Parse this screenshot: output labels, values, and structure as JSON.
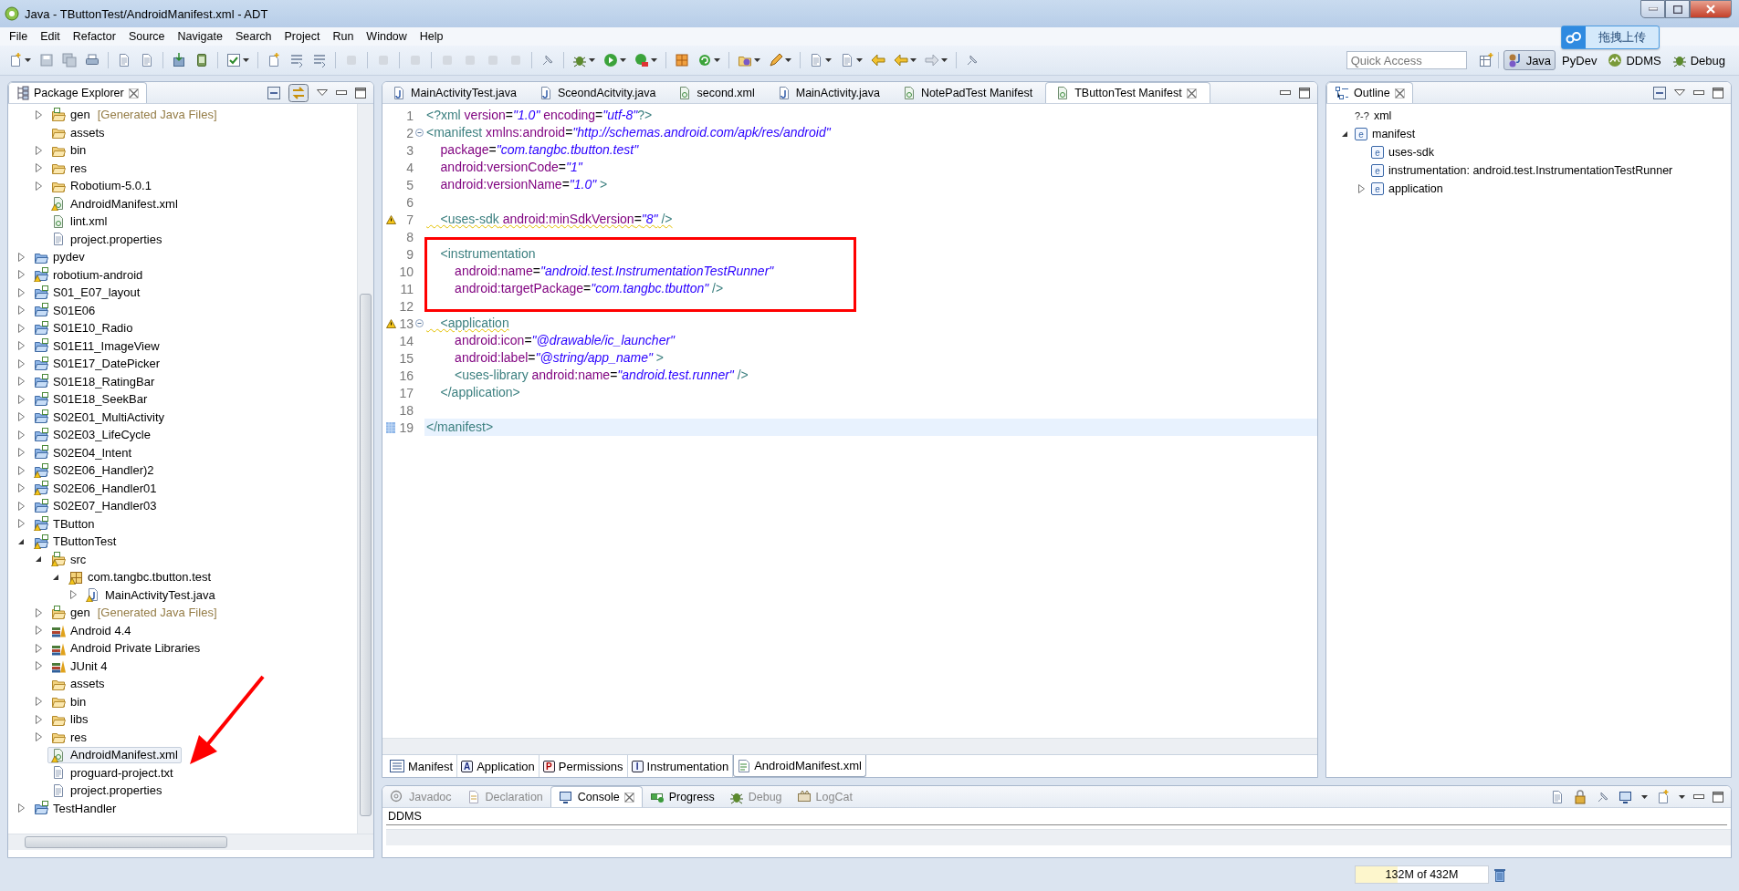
{
  "window": {
    "title": "Java - TButtonTest/AndroidManifest.xml - ADT"
  },
  "menu": [
    "File",
    "Edit",
    "Refactor",
    "Source",
    "Navigate",
    "Search",
    "Project",
    "Run",
    "Window",
    "Help"
  ],
  "quick_access": {
    "placeholder": "Quick Access"
  },
  "perspectives": [
    {
      "label": "Java",
      "kind": "java",
      "selected": true
    },
    {
      "label": "PyDev",
      "kind": "pydev",
      "selected": false
    },
    {
      "label": "DDMS",
      "kind": "ddms",
      "selected": false
    },
    {
      "label": "Debug",
      "kind": "debug",
      "selected": false
    }
  ],
  "upload_widget": {
    "label": "拖拽上传"
  },
  "package_explorer": {
    "title": "Package Explorer",
    "scrolled_children": [
      {
        "label": "gen",
        "note": "[Generated Java Files]",
        "kind": "source-folder",
        "expanded": false,
        "warning": false,
        "selected": false
      },
      {
        "label": "assets",
        "kind": "folder",
        "warning": false,
        "selected": false
      },
      {
        "label": "bin",
        "kind": "folder",
        "expanded": false,
        "warning": false,
        "selected": false
      },
      {
        "label": "res",
        "kind": "folder",
        "expanded": false,
        "warning": false,
        "selected": false
      },
      {
        "label": "Robotium-5.0.1",
        "kind": "plain-folder",
        "expanded": false,
        "warning": false,
        "selected": false
      },
      {
        "label": "AndroidManifest.xml",
        "kind": "xml-file",
        "warning": true,
        "selected": false
      },
      {
        "label": "lint.xml",
        "kind": "xml-file",
        "warning": false,
        "selected": false
      },
      {
        "label": "project.properties",
        "kind": "text-file",
        "warning": false,
        "selected": false
      }
    ],
    "projects": [
      {
        "label": "pydev",
        "kind": "project",
        "expanded": false,
        "warning": false,
        "selected": false
      },
      {
        "label": "robotium-android",
        "kind": "android-project",
        "expanded": false,
        "warning": true,
        "selected": false
      },
      {
        "label": "S01_E07_layout",
        "kind": "android-project",
        "expanded": false,
        "warning": false,
        "selected": false
      },
      {
        "label": "S01E06",
        "kind": "android-project",
        "expanded": false,
        "warning": false,
        "selected": false
      },
      {
        "label": "S01E10_Radio",
        "kind": "android-project",
        "expanded": false,
        "warning": false,
        "selected": false
      },
      {
        "label": "S01E11_ImageView",
        "kind": "android-project",
        "expanded": false,
        "warning": false,
        "selected": false
      },
      {
        "label": "S01E17_DatePicker",
        "kind": "android-project",
        "expanded": false,
        "warning": false,
        "selected": false
      },
      {
        "label": "S01E18_RatingBar",
        "kind": "android-project",
        "expanded": false,
        "warning": false,
        "selected": false
      },
      {
        "label": "S01E18_SeekBar",
        "kind": "android-project",
        "expanded": false,
        "warning": false,
        "selected": false
      },
      {
        "label": "S02E01_MultiActivity",
        "kind": "android-project",
        "expanded": false,
        "warning": false,
        "selected": false
      },
      {
        "label": "S02E03_LifeCycle",
        "kind": "android-project",
        "expanded": false,
        "warning": false,
        "selected": false
      },
      {
        "label": "S02E04_Intent",
        "kind": "android-project",
        "expanded": false,
        "warning": false,
        "selected": false
      },
      {
        "label": "S02E06_Handler)2",
        "kind": "android-project",
        "expanded": false,
        "warning": true,
        "selected": false
      },
      {
        "label": "S02E06_Handler01",
        "kind": "android-project",
        "expanded": false,
        "warning": true,
        "selected": false
      },
      {
        "label": "S02E07_Handler03",
        "kind": "android-project",
        "expanded": false,
        "warning": false,
        "selected": false
      },
      {
        "label": "TButton",
        "kind": "android-project",
        "expanded": false,
        "warning": true,
        "selected": false
      },
      {
        "label": "TButtonTest",
        "kind": "android-project",
        "expanded": true,
        "warning": true,
        "selected": false,
        "children": [
          {
            "label": "src",
            "kind": "source-folder",
            "expanded": true,
            "warning": true,
            "selected": false,
            "children": [
              {
                "label": "com.tangbc.tbutton.test",
                "kind": "package",
                "expanded": true,
                "warning": true,
                "selected": false,
                "children": [
                  {
                    "label": "MainActivityTest.java",
                    "kind": "java-file",
                    "expanded": false,
                    "warning": true,
                    "selected": false
                  }
                ]
              }
            ]
          },
          {
            "label": "gen",
            "note": "[Generated Java Files]",
            "kind": "source-folder",
            "expanded": false,
            "warning": false,
            "selected": false
          },
          {
            "label": "Android 4.4",
            "kind": "library",
            "expanded": false,
            "warning": false,
            "selected": false
          },
          {
            "label": "Android Private Libraries",
            "kind": "library",
            "expanded": false,
            "warning": false,
            "selected": false
          },
          {
            "label": "JUnit 4",
            "kind": "library",
            "expanded": false,
            "warning": false,
            "selected": false
          },
          {
            "label": "assets",
            "kind": "folder",
            "warning": false,
            "selected": false
          },
          {
            "label": "bin",
            "kind": "folder",
            "expanded": false,
            "warning": false,
            "selected": false
          },
          {
            "label": "libs",
            "kind": "folder",
            "expanded": false,
            "warning": false,
            "selected": false
          },
          {
            "label": "res",
            "kind": "folder",
            "expanded": false,
            "warning": false,
            "selected": false
          },
          {
            "label": "AndroidManifest.xml",
            "kind": "xml-file",
            "warning": true,
            "selected": true
          },
          {
            "label": "proguard-project.txt",
            "kind": "text-file",
            "warning": false,
            "selected": false
          },
          {
            "label": "project.properties",
            "kind": "text-file",
            "warning": false,
            "selected": false
          }
        ]
      },
      {
        "label": "TestHandler",
        "kind": "android-project",
        "expanded": false,
        "warning": false,
        "selected": false
      }
    ]
  },
  "editor": {
    "tabs": [
      {
        "label": "MainActivityTest.java",
        "kind": "java",
        "selected": false
      },
      {
        "label": "SceondAcitvity.java",
        "kind": "java",
        "selected": false
      },
      {
        "label": "second.xml",
        "kind": "xml",
        "selected": false
      },
      {
        "label": "MainActivity.java",
        "kind": "java",
        "selected": false
      },
      {
        "label": "NotePadTest Manifest",
        "kind": "xml",
        "selected": false
      },
      {
        "label": "TButtonTest Manifest",
        "kind": "xml",
        "selected": true
      }
    ],
    "lines": [
      {
        "number": "1",
        "segments": [
          {
            "kind": "tag",
            "text": "<?xml"
          },
          {
            "kind": "attr",
            "text": " version"
          },
          {
            "kind": "eq",
            "text": "="
          },
          {
            "kind": "value",
            "text": "\"1.0\""
          },
          {
            "kind": "attr",
            "text": " encoding"
          },
          {
            "kind": "eq",
            "text": "="
          },
          {
            "kind": "value",
            "text": "\"utf-8\""
          },
          {
            "kind": "tag",
            "text": "?>"
          }
        ]
      },
      {
        "number": "2",
        "collapsible": true,
        "segments": [
          {
            "kind": "tag",
            "text": "<manifest"
          },
          {
            "kind": "attr",
            "text": " xmlns:android"
          },
          {
            "kind": "eq",
            "text": "="
          },
          {
            "kind": "value",
            "text": "\"http://schemas.android.com/apk/res/android\""
          }
        ]
      },
      {
        "number": "3",
        "segments": [
          {
            "kind": "attr",
            "text": "    package"
          },
          {
            "kind": "eq",
            "text": "="
          },
          {
            "kind": "value",
            "text": "\"com.tangbc.tbutton.test\""
          }
        ]
      },
      {
        "number": "4",
        "segments": [
          {
            "kind": "attr",
            "text": "    android:versionCode"
          },
          {
            "kind": "eq",
            "text": "="
          },
          {
            "kind": "value",
            "text": "\"1\""
          }
        ]
      },
      {
        "number": "5",
        "segments": [
          {
            "kind": "attr",
            "text": "    android:versionName"
          },
          {
            "kind": "eq",
            "text": "="
          },
          {
            "kind": "value",
            "text": "\"1.0\""
          },
          {
            "kind": "tag",
            "text": " >"
          }
        ]
      },
      {
        "number": "6"
      },
      {
        "number": "7",
        "warning": true,
        "segments": [
          {
            "kind": "tag",
            "text": "    <uses-sdk"
          },
          {
            "kind": "attr",
            "text": " android:minSdkVersion"
          },
          {
            "kind": "eq",
            "text": "="
          },
          {
            "kind": "value",
            "text": "\"8\""
          },
          {
            "kind": "tag",
            "text": " />"
          }
        ]
      },
      {
        "number": "8"
      },
      {
        "number": "9",
        "segments": [
          {
            "kind": "tag",
            "text": "    <instrumentation"
          }
        ]
      },
      {
        "number": "10",
        "segments": [
          {
            "kind": "attr",
            "text": "        android:name"
          },
          {
            "kind": "eq",
            "text": "="
          },
          {
            "kind": "value",
            "text": "\"android.test.InstrumentationTestRunner\""
          }
        ]
      },
      {
        "number": "11",
        "segments": [
          {
            "kind": "attr",
            "text": "        android:targetPackage"
          },
          {
            "kind": "eq",
            "text": "="
          },
          {
            "kind": "value",
            "text": "\"com.tangbc.tbutton\""
          },
          {
            "kind": "tag",
            "text": " />"
          }
        ]
      },
      {
        "number": "12"
      },
      {
        "number": "13",
        "warning": true,
        "collapsible": true,
        "segments": [
          {
            "kind": "tag",
            "text": "    <application"
          }
        ]
      },
      {
        "number": "14",
        "segments": [
          {
            "kind": "attr",
            "text": "        android:icon"
          },
          {
            "kind": "eq",
            "text": "="
          },
          {
            "kind": "value",
            "text": "\"@drawable/ic_launcher\""
          }
        ]
      },
      {
        "number": "15",
        "segments": [
          {
            "kind": "attr",
            "text": "        android:label"
          },
          {
            "kind": "eq",
            "text": "="
          },
          {
            "kind": "value",
            "text": "\"@string/app_name\""
          },
          {
            "kind": "tag",
            "text": " >"
          }
        ]
      },
      {
        "number": "16",
        "segments": [
          {
            "kind": "tag",
            "text": "        <uses-library"
          },
          {
            "kind": "attr",
            "text": " android:name"
          },
          {
            "kind": "eq",
            "text": "="
          },
          {
            "kind": "value",
            "text": "\"android.test.runner\""
          },
          {
            "kind": "tag",
            "text": " />"
          }
        ]
      },
      {
        "number": "17",
        "segments": [
          {
            "kind": "tag",
            "text": "    </application>"
          }
        ]
      },
      {
        "number": "18"
      },
      {
        "number": "19",
        "current": true,
        "segments": [
          {
            "kind": "tag",
            "text": "</manifest>"
          }
        ]
      }
    ],
    "page_tabs": [
      {
        "label": "Manifest",
        "kind": "overview",
        "selected": false
      },
      {
        "label": "Application",
        "kind": "letter",
        "icon_text": "A",
        "selected": false
      },
      {
        "label": "Permissions",
        "kind": "letter",
        "icon_text": "P",
        "selected": false
      },
      {
        "label": "Instrumentation",
        "kind": "letter",
        "icon_text": "I",
        "selected": false
      },
      {
        "label": "AndroidManifest.xml",
        "kind": "source",
        "selected": true
      }
    ]
  },
  "outline": {
    "title": "Outline",
    "items": [
      {
        "label": "xml",
        "icon_text": "?-?",
        "kind": "declaration"
      },
      {
        "label": "manifest",
        "icon_text": "e",
        "kind": "element",
        "expanded": true,
        "children": [
          {
            "label": "uses-sdk",
            "icon_text": "e",
            "kind": "element"
          },
          {
            "label": "instrumentation: android.test.InstrumentationTestRunner",
            "icon_text": "e",
            "kind": "element"
          },
          {
            "label": "application",
            "icon_text": "e",
            "kind": "element",
            "expanded": false
          }
        ]
      }
    ]
  },
  "console": {
    "tabs": [
      {
        "label": "Javadoc",
        "kind": "javadoc",
        "selected": false,
        "disabled": true
      },
      {
        "label": "Declaration",
        "kind": "declaration",
        "selected": false,
        "disabled": true
      },
      {
        "label": "Console",
        "kind": "console",
        "selected": true,
        "disabled": false
      },
      {
        "label": "Progress",
        "kind": "progress",
        "selected": false,
        "disabled": false
      },
      {
        "label": "Debug",
        "kind": "debug",
        "selected": false,
        "disabled": true
      },
      {
        "label": "LogCat",
        "kind": "logcat",
        "selected": false,
        "disabled": true
      }
    ],
    "content": "DDMS"
  },
  "heap": {
    "reading": "132M of 432M",
    "level": 0.32
  }
}
